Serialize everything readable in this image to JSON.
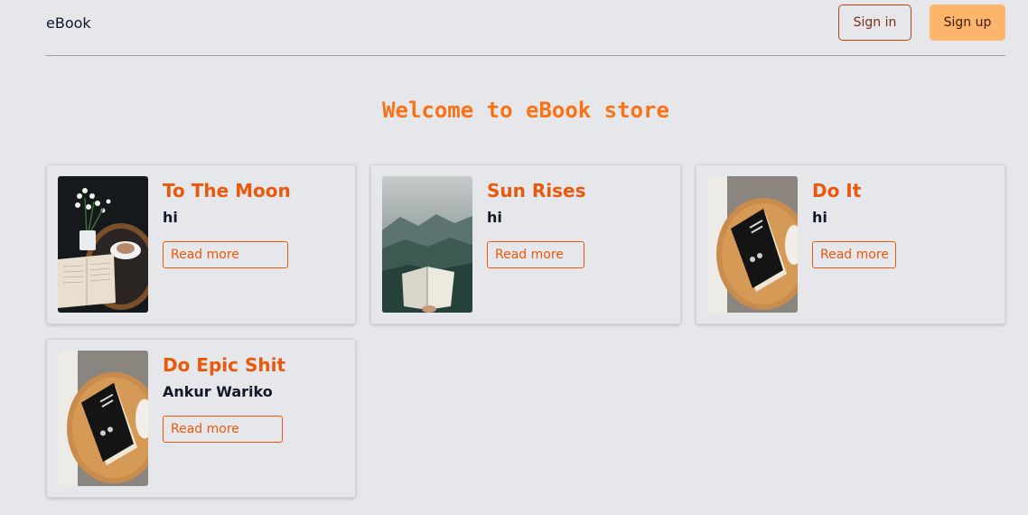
{
  "header": {
    "brand": "eBook",
    "signin_label": "Sign in",
    "signup_label": "Sign up"
  },
  "main": {
    "title": "Welcome to eBook store"
  },
  "books": [
    {
      "title": "To The Moon",
      "author": "hi",
      "action_label": "Read more"
    },
    {
      "title": "Sun Rises",
      "author": "hi",
      "action_label": "Read more"
    },
    {
      "title": "Do It",
      "author": "hi",
      "action_label": "Read more"
    },
    {
      "title": "Do Epic Shit",
      "author": "Ankur Wariko",
      "action_label": "Read more"
    }
  ],
  "colors": {
    "accent": "#ea580c",
    "title": "#f97316",
    "signup_bg": "#fdb46b",
    "background": "#e5e7eb"
  }
}
